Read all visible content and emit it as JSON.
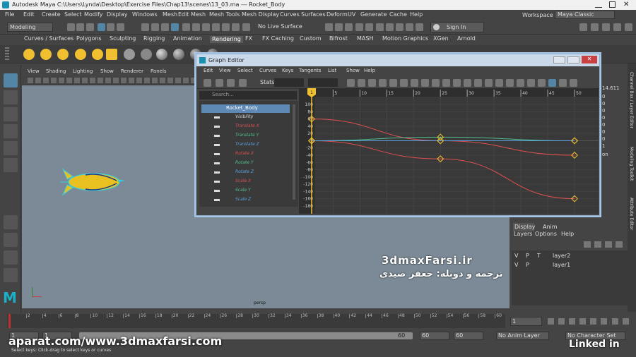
{
  "window": {
    "title": "Autodesk Maya C:\\Users\\Lynda\\Desktop\\Exercise Files\\Chap13\\scenes\\13_03.ma  ---  Rocket_Body"
  },
  "menubar": [
    "File",
    "Edit",
    "Create",
    "Select",
    "Modify",
    "Display",
    "Windows",
    "Mesh",
    "Edit Mesh",
    "Mesh Tools",
    "Mesh Display",
    "Curves",
    "Surfaces",
    "Deform",
    "UV",
    "Generate",
    "Cache",
    "Help"
  ],
  "workspace": {
    "label": "Workspace :",
    "value": "Maya Classic"
  },
  "status": {
    "mode": "Modeling",
    "live_surface": "No Live Surface",
    "sign_in": "Sign In"
  },
  "shelf_tabs": [
    "Curves / Surfaces",
    "Polygons",
    "Sculpting",
    "Rigging",
    "Animation",
    "Rendering",
    "FX",
    "FX Caching",
    "Custom",
    "Bifrost",
    "MASH",
    "Motion Graphics",
    "XGen",
    "Arnold"
  ],
  "shelf_active": "Rendering",
  "viewport": {
    "menu": [
      "View",
      "Shading",
      "Lighting",
      "Show",
      "Renderer",
      "Panels"
    ],
    "camera_label": "persp"
  },
  "graph_editor": {
    "title": "Graph Editor",
    "menu": [
      "Edit",
      "View",
      "Select",
      "Curves",
      "Keys",
      "Tangents",
      "List",
      "Show",
      "Help"
    ],
    "stats_label": "Stats",
    "search_placeholder": "Search...",
    "outliner_root": "Rocket_Body",
    "channels": [
      {
        "name": "Visibility",
        "color": "#d8d8d8"
      },
      {
        "name": "Translate X",
        "color": "#e05050"
      },
      {
        "name": "Translate Y",
        "color": "#4fc08a"
      },
      {
        "name": "Translate Z",
        "color": "#5aa0e0"
      },
      {
        "name": "Rotate X",
        "color": "#e05050"
      },
      {
        "name": "Rotate Y",
        "color": "#4fc08a"
      },
      {
        "name": "Rotate Z",
        "color": "#5aa0e0"
      },
      {
        "name": "Scale X",
        "color": "#e05050"
      },
      {
        "name": "Scale Y",
        "color": "#4fc08a"
      },
      {
        "name": "Scale Z",
        "color": "#5aa0e0"
      }
    ],
    "frame_ticks": [
      "1",
      "5",
      "10",
      "15",
      "20",
      "25",
      "30",
      "35",
      "40",
      "45",
      "50"
    ],
    "current_frame": "1",
    "value_ticks": [
      "100",
      "80",
      "60",
      "40",
      "20",
      "0",
      "-20",
      "-40",
      "-60",
      "-80",
      "-100",
      "-120",
      "-140",
      "-160",
      "-180"
    ]
  },
  "chart_data": {
    "type": "line",
    "x_range": [
      1,
      50
    ],
    "y_range": [
      -190,
      110
    ],
    "series": [
      {
        "color": "#e05050",
        "points": [
          [
            1,
            60
          ],
          [
            25,
            0
          ],
          [
            50,
            -40
          ]
        ]
      },
      {
        "color": "#e05050",
        "points": [
          [
            1,
            0
          ],
          [
            25,
            -50
          ],
          [
            50,
            -160
          ]
        ]
      },
      {
        "color": "#4fc08a",
        "points": [
          [
            1,
            0
          ],
          [
            25,
            10
          ],
          [
            50,
            0
          ]
        ]
      },
      {
        "color": "#5aa0e0",
        "points": [
          [
            1,
            0
          ],
          [
            25,
            0
          ],
          [
            50,
            0
          ]
        ]
      }
    ],
    "grid": true
  },
  "channel_box": {
    "value": "14.611",
    "labels": [
      "0",
      "0",
      "0",
      "0",
      "0",
      "0",
      "0",
      "1",
      "on"
    ]
  },
  "side_tabs": [
    "Channel Box / Layer Editor",
    "Modeling Toolkit",
    "Attribute Editor"
  ],
  "layers": {
    "tabs": [
      "Display",
      "Anim"
    ],
    "menu": [
      "Layers",
      "Options",
      "Help"
    ],
    "items": [
      {
        "v": "V",
        "p": "P",
        "t": "T",
        "name": "layer2"
      },
      {
        "v": "V",
        "p": "P",
        "t": "",
        "name": "layer1"
      }
    ]
  },
  "timeline": {
    "ticks": [
      "2",
      "4",
      "6",
      "8",
      "10",
      "12",
      "14",
      "16",
      "18",
      "20",
      "22",
      "24",
      "26",
      "28",
      "30",
      "32",
      "34",
      "36",
      "38",
      "40",
      "42",
      "44",
      "46",
      "48",
      "50",
      "52",
      "54",
      "56",
      "58",
      "60"
    ],
    "current": "1",
    "range_start": "1",
    "range_end": "60",
    "anim_start": "60",
    "anim_end": "60",
    "anim_layer": "No Anim Layer",
    "character": "No Character Set"
  },
  "help_line": "Select keys: Click-drag to select keys or curves",
  "watermarks": {
    "site": "3dmaxFarsi.ir",
    "persian": "ترجمه و دوبله: جعفر صیدی",
    "aparat": "aparat.com/www.3dmaxfarsi.com",
    "linkedin": "Linked in"
  },
  "colors": {
    "accent": "#5285a6",
    "selected_row": "#5d89b4",
    "red_curve": "#e05050",
    "green_curve": "#4fc08a",
    "blue_curve": "#5aa0e0",
    "key_marker": "#f0c030"
  }
}
